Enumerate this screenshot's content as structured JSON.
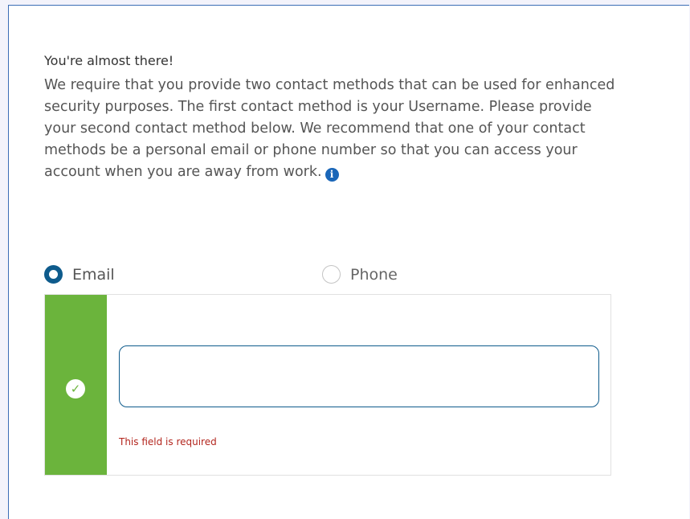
{
  "intro": {
    "headline": "You're almost there!",
    "body": "We require that you provide two contact methods that can be used for enhanced security purposes. The first contact method is your Username. Please provide your second contact method below. We recommend that one of your contact methods be a personal email or phone number so that you can access your account when you are away from work.",
    "info_icon_glyph": "i"
  },
  "contact_method": {
    "selected": "Email",
    "options": [
      {
        "label": "Email",
        "checked": true
      },
      {
        "label": "Phone",
        "checked": false
      }
    ]
  },
  "email_entry": {
    "value": "",
    "placeholder": "",
    "error": "This field is required",
    "status_icon": "check-icon"
  },
  "colors": {
    "accent": "#0e5b8c",
    "status_valid": "#6bb43c",
    "error": "#b3261e",
    "info": "#1a66b8"
  }
}
